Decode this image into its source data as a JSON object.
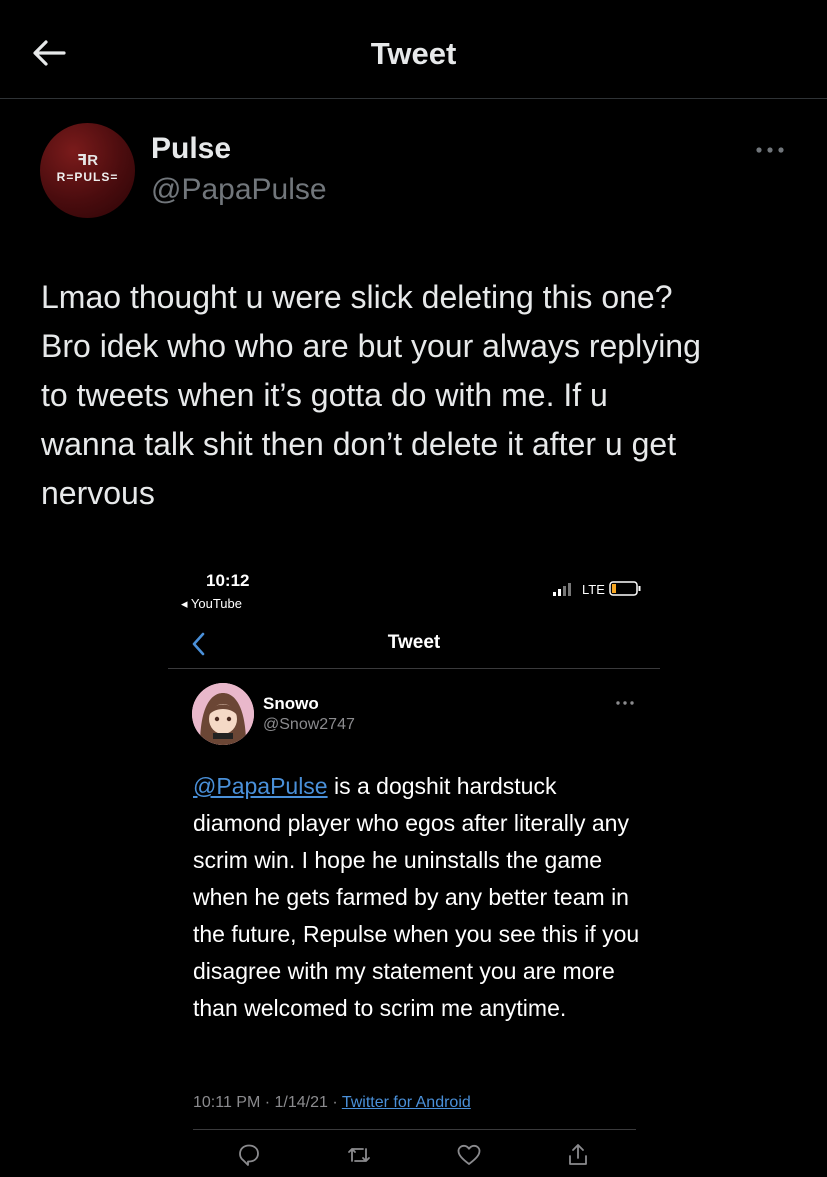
{
  "header": {
    "title": "Tweet",
    "back_icon": "arrow-left-icon"
  },
  "tweet": {
    "author": {
      "name": "Pulse",
      "handle": "@PapaPulse",
      "avatar_mark": "ꟻR",
      "avatar_text": "R=PULS=",
      "avatar_color": "#5a1012"
    },
    "text": "Lmao thought u were slick deleting this one?\nBro idek who who are but your always replying\nto tweets when it’s gotta do with me. If u\nwanna talk shit then don’t delete it after u get\nnervous",
    "more_icon": "more-horizontal-icon"
  },
  "embedded_screenshot": {
    "status_bar": {
      "time": "10:12",
      "back_app": "◂ YouTube",
      "network": "LTE",
      "signal_icon": "signal-icon",
      "battery_icon": "battery-icon"
    },
    "nav": {
      "title": "Tweet",
      "back_icon": "chevron-left-icon"
    },
    "tweet": {
      "name": "Snowo",
      "handle": "@Snow2747",
      "mention": "@PapaPulse",
      "text": " is a dogshit hardstuck diamond player who egos after literally any scrim win. I hope he uninstalls the game when he gets farmed by any better team in the future, Repulse when you see this if you disagree with my statement you are more than welcomed to scrim me anytime.",
      "meta": "10:11 PM · 1/14/21 · ",
      "source": "Twitter for Android",
      "more_icon": "more-horizontal-icon"
    },
    "actions": [
      "reply-icon",
      "retweet-icon",
      "like-icon",
      "share-icon"
    ],
    "accent_color": "#4a90d9"
  }
}
